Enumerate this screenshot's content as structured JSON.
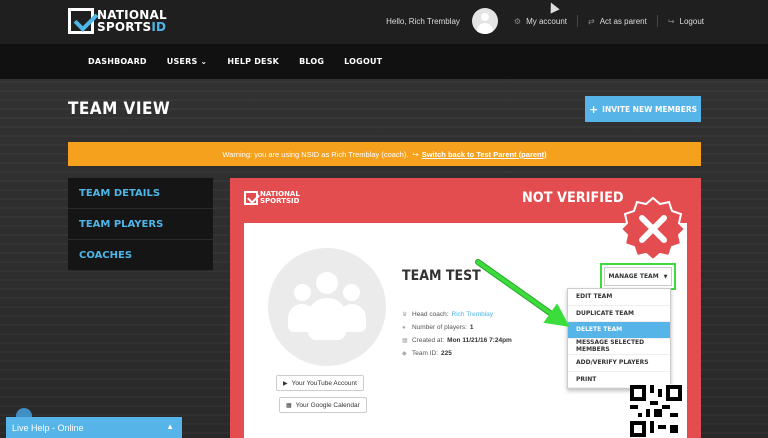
{
  "header": {
    "logo_line1": "NATIONAL",
    "logo_line2a": "SPORTS",
    "logo_line2b": "ID",
    "hello": "Hello, Rich Tremblay",
    "my_account": "My account",
    "act_as_parent": "Act as parent",
    "logout": "Logout"
  },
  "nav": {
    "items": [
      "DASHBOARD",
      "USERS ⌄",
      "HELP DESK",
      "BLOG",
      "LOGOUT"
    ]
  },
  "page": {
    "title": "TEAM VIEW",
    "invite_button": "INVITE NEW MEMBERS"
  },
  "warning": {
    "text": "Warning: you are using NSID as Rich Tremblay (coach).",
    "link": "Switch back to Test Parent (parent)"
  },
  "sidebar": {
    "items": [
      "TEAM DETAILS",
      "TEAM PLAYERS",
      "COACHES"
    ]
  },
  "card": {
    "logo_line1": "NATIONAL",
    "logo_line2": "SPORTSID",
    "status": "NOT VERIFIED",
    "team_name": "TEAM TEST",
    "head_coach_label": "Head coach:",
    "head_coach_value": "Rich Tremblay",
    "players_label": "Number of players:",
    "players_value": "1",
    "created_label": "Created at:",
    "created_value": "Mon 11/21/16 7:24pm",
    "team_id_label": "Team ID:",
    "team_id_value": "225",
    "youtube_button": "Your YouTube Account",
    "google_button": "Your Google Calendar",
    "manage_button": "MANAGE TEAM"
  },
  "dropdown": {
    "items": [
      "EDIT TEAM",
      "DUPLICATE TEAM",
      "DELETE TEAM",
      "MESSAGE SELECTED MEMBERS",
      "ADD/VERIFY PLAYERS",
      "PRINT"
    ],
    "active": "DELETE TEAM"
  },
  "livehelp": {
    "label": "Live Help - Online"
  },
  "colors": {
    "accent": "#56b4e8",
    "warning": "#f6a11e",
    "card_red": "#e34d4f",
    "highlight_green": "#3ddc3d"
  }
}
